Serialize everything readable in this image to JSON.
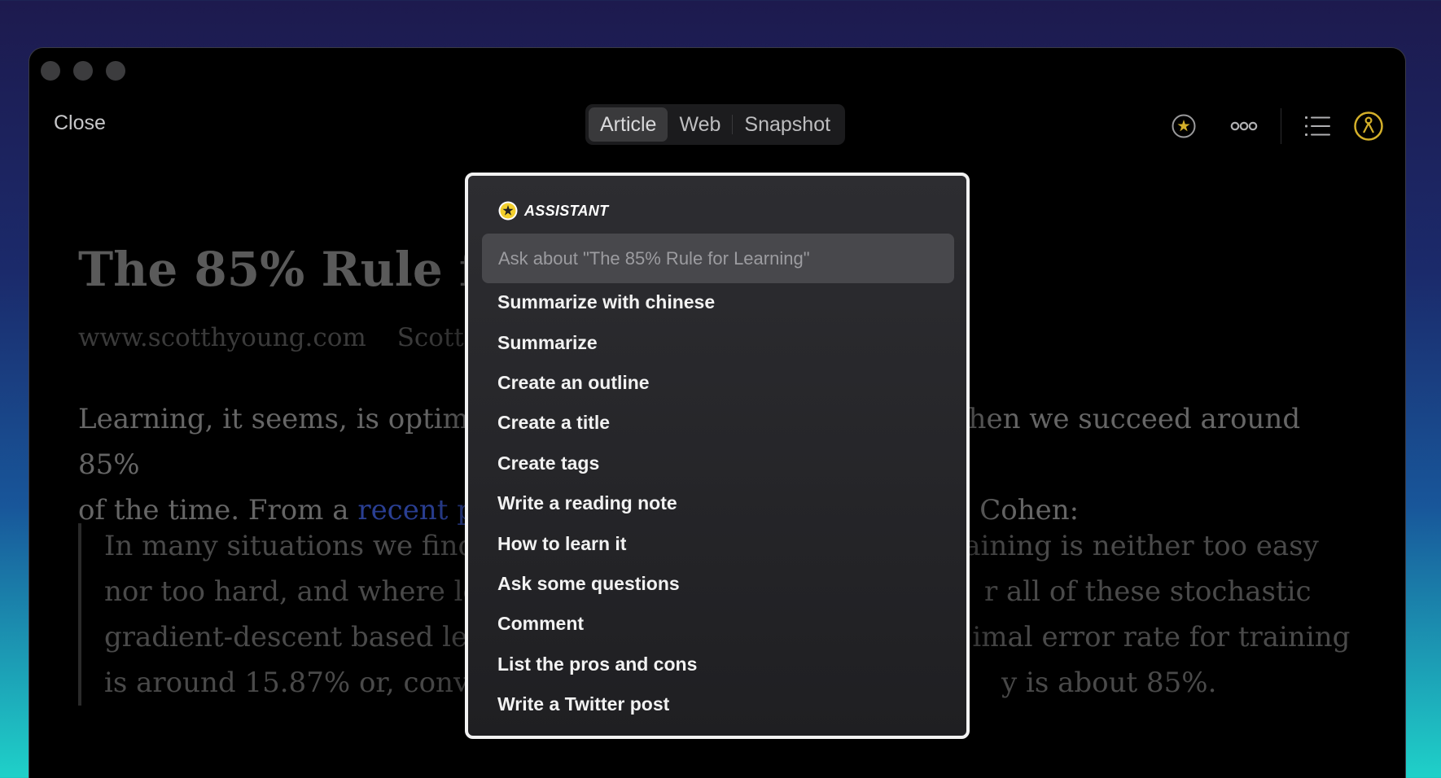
{
  "window": {
    "close_label": "Close",
    "tabs": [
      {
        "label": "Article",
        "active": true
      },
      {
        "label": "Web",
        "active": false
      },
      {
        "label": "Snapshot",
        "active": false
      }
    ],
    "toolbar_icons": [
      "assistant-icon",
      "more-icon",
      "list-icon",
      "profile-icon"
    ],
    "accent_color": "#d4b02a"
  },
  "article": {
    "title": "The 85% Rule for",
    "site": "www.scotthyoung.com",
    "author": "Scott Y",
    "para_part1": "Learning, it seems, is optimiz",
    "para_part2": "hen we succeed around 85%",
    "para_part3": "of the time. From a ",
    "para_link": "recent pa",
    "para_part4": "Cohen:",
    "quote_lines": [
      {
        "left": "In many situations we find",
        "right": "aining is neither too easy"
      },
      {
        "left": "nor too hard, and where lea",
        "right": "r all of these stochastic"
      },
      {
        "left": "gradient-descent based lea",
        "right": "imal error rate for training"
      },
      {
        "left": "is around 15.87% or, convers",
        "right": "y is about 85%."
      }
    ]
  },
  "assistant": {
    "title": "ASSISTANT",
    "placeholder": "Ask about \"The 85% Rule for Learning\"",
    "items": [
      "Summarize with chinese",
      "Summarize",
      "Create an outline",
      "Create a title",
      "Create tags",
      "Write a reading note",
      "How to learn it",
      "Ask some questions",
      "Comment",
      "List the pros and cons",
      "Write a Twitter post"
    ]
  }
}
